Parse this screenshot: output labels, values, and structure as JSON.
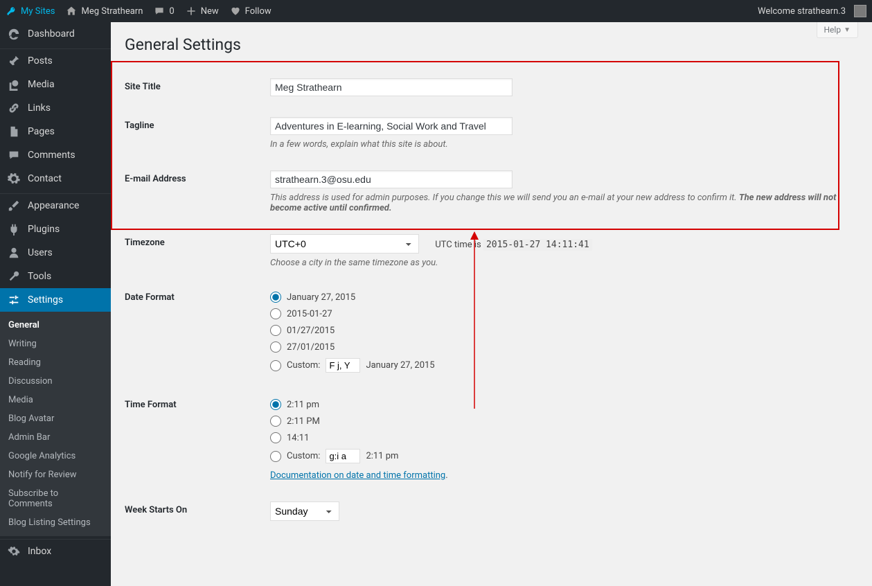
{
  "adminbar": {
    "my_sites": "My Sites",
    "site_name": "Meg Strathearn",
    "comments_count": "0",
    "new": "New",
    "follow": "Follow",
    "welcome": "Welcome strathearn.3"
  },
  "sidebar": {
    "dashboard": "Dashboard",
    "posts": "Posts",
    "media": "Media",
    "links": "Links",
    "pages": "Pages",
    "comments": "Comments",
    "contact": "Contact",
    "appearance": "Appearance",
    "plugins": "Plugins",
    "users": "Users",
    "tools": "Tools",
    "settings": "Settings",
    "inbox": "Inbox",
    "sub": {
      "general": "General",
      "writing": "Writing",
      "reading": "Reading",
      "discussion": "Discussion",
      "media": "Media",
      "blog_avatar": "Blog Avatar",
      "admin_bar": "Admin Bar",
      "google_analytics": "Google Analytics",
      "notify": "Notify for Review",
      "subscribe": "Subscribe to Comments",
      "blog_listing": "Blog Listing Settings"
    }
  },
  "page": {
    "title": "General Settings",
    "help": "Help"
  },
  "form": {
    "site_title_label": "Site Title",
    "site_title_value": "Meg Strathearn",
    "tagline_label": "Tagline",
    "tagline_value": "Adventures in E-learning, Social Work and Travel",
    "tagline_desc": "In a few words, explain what this site is about.",
    "email_label": "E-mail Address",
    "email_value": "strathearn.3@osu.edu",
    "email_desc_a": "This address is used for admin purposes. If you change this we will send you an e-mail at your new address to confirm it. ",
    "email_desc_b": "The new address will not become active until confirmed.",
    "tz_label": "Timezone",
    "tz_value": "UTC+0",
    "tz_utc_prefix": "UTC time is ",
    "tz_utc_value": "2015-01-27 14:11:41",
    "tz_desc": "Choose a city in the same timezone as you.",
    "df_label": "Date Format",
    "df_opt1": "January 27, 2015",
    "df_opt2": "2015-01-27",
    "df_opt3": "01/27/2015",
    "df_opt4": "27/01/2015",
    "df_custom_label": "Custom:",
    "df_custom_value": "F j, Y",
    "df_custom_preview": "January 27, 2015",
    "tf_label": "Time Format",
    "tf_opt1": "2:11 pm",
    "tf_opt2": "2:11 PM",
    "tf_opt3": "14:11",
    "tf_custom_label": "Custom:",
    "tf_custom_value": "g:i a",
    "tf_custom_preview": "2:11 pm",
    "doc_link": "Documentation on date and time formatting",
    "wso_label": "Week Starts On",
    "wso_value": "Sunday"
  }
}
